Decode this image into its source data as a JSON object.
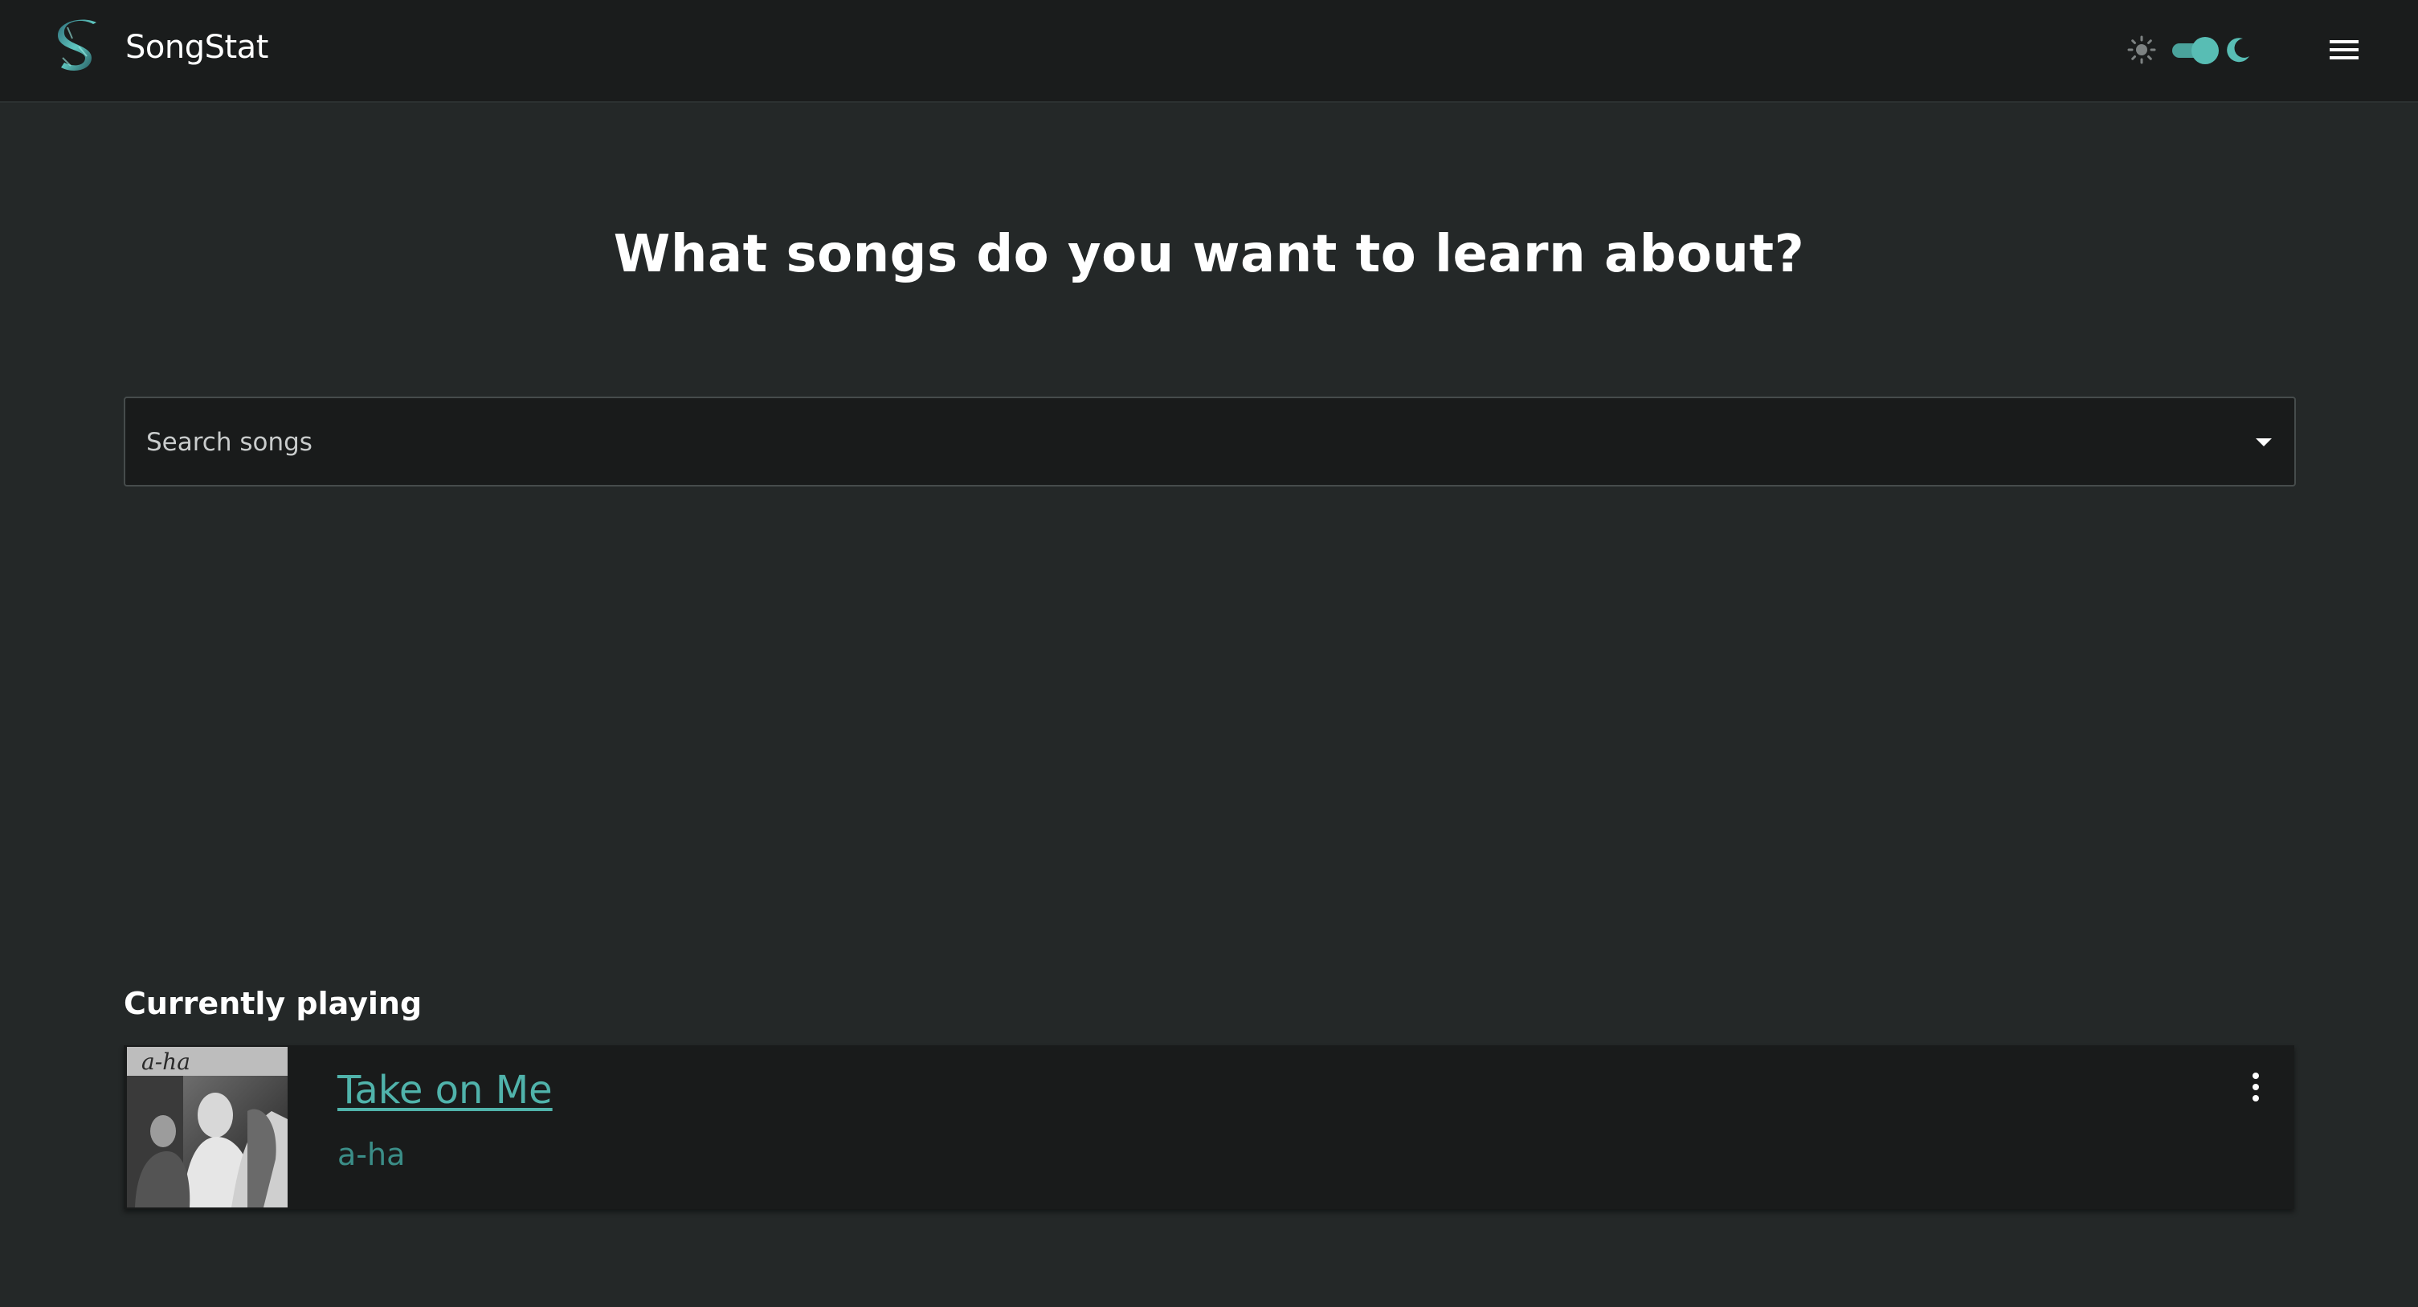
{
  "header": {
    "brand": "SongStat",
    "icons": {
      "logo": "stylized-s-logo-icon",
      "light_mode": "sun-icon",
      "dark_mode": "moon-icon",
      "menu": "hamburger-menu-icon"
    },
    "theme_toggle_on": true
  },
  "main": {
    "headline": "What songs do you want to learn about?",
    "search": {
      "placeholder": "Search songs",
      "value": ""
    }
  },
  "now_playing": {
    "section_title": "Currently playing",
    "track": {
      "title": "Take on Me",
      "artist": "a-ha",
      "cover_text": "a-ha"
    }
  },
  "colors": {
    "background": "#242828",
    "header": "#1a1c1c",
    "accent": "#50b3ab",
    "accent_dim": "#3b8e88",
    "card": "#191b1b"
  }
}
